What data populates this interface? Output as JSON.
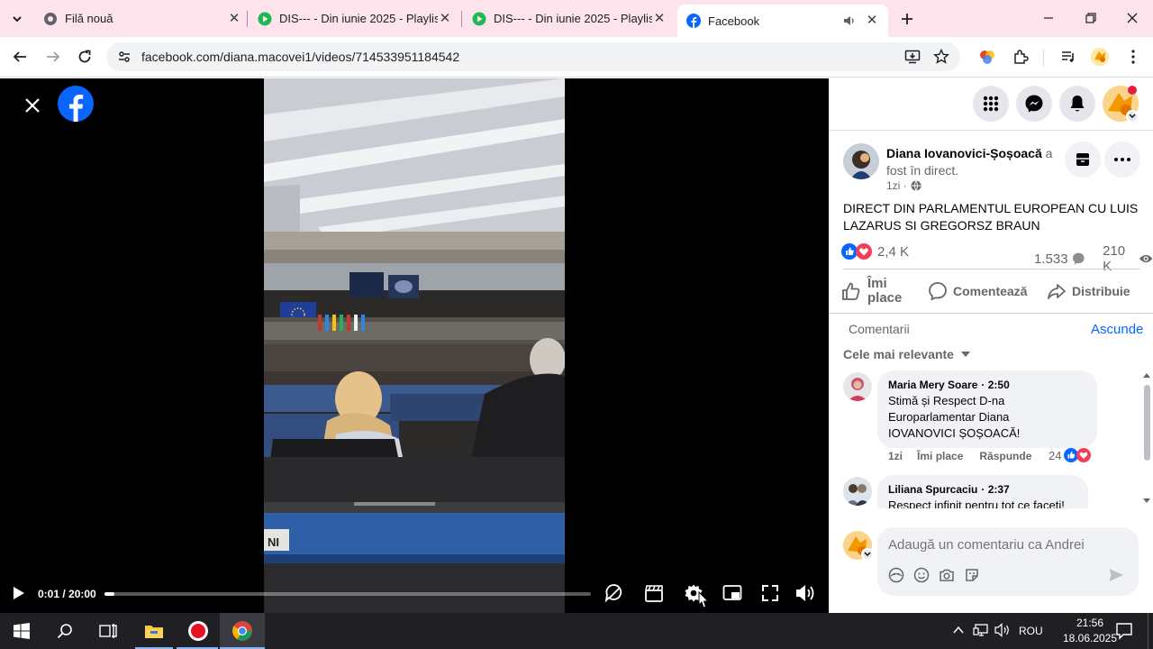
{
  "browser": {
    "tabs": [
      {
        "title": "Filă nouă"
      },
      {
        "title": "DIS--- - Din iunie 2025 - Playlist"
      },
      {
        "title": "DIS--- - Din iunie 2025 - Playlist"
      },
      {
        "title": "Facebook",
        "active": true
      }
    ],
    "url": "facebook.com/diana.macovei1/videos/714533951184542"
  },
  "video": {
    "time": "0:01 / 20:00",
    "progress": 0.001,
    "seat_label": "NI"
  },
  "post": {
    "author": "Diana Iovanovici-Șoșoacă",
    "author_suffix": "a",
    "status": "fost în direct.",
    "age": "1zi ·",
    "title": "DIRECT DIN PARLAMENTUL EUROPEAN CU LUIS LAZARUS SI GREGORSZ BRAUN",
    "reactions_count": "2,4 K",
    "comments_count": "1.533",
    "views_count": "210 K",
    "actions": {
      "like": "Îmi place",
      "comment": "Comentează",
      "share": "Distribuie"
    }
  },
  "comments": {
    "header": "Comentarii",
    "hide": "Ascunde",
    "sort": "Cele mai relevante",
    "items": [
      {
        "author": "Maria Mery Soare",
        "time": "· 2:50",
        "text": "Stimă și Respect D-na Europarlamentar Diana IOVANOVICI ȘOȘOACĂ!",
        "age": "1zi",
        "like": "Îmi place",
        "reply": "Răspunde",
        "reactions": "24"
      },
      {
        "author": "Liliana Spurcaciu",
        "time": "· 2:37",
        "text": "Respect infinit pentru tot ce faceți!"
      }
    ],
    "input_placeholder": "Adaugă un comentariu ca Andrei"
  },
  "taskbar": {
    "lang": "ROU",
    "time": "21:56",
    "date": "18.06.2025"
  },
  "colors": {
    "facebook_blue": "#0866ff",
    "tabstrip_bg": "#fce3ec",
    "taskbar_bg": "#1f1f24"
  }
}
